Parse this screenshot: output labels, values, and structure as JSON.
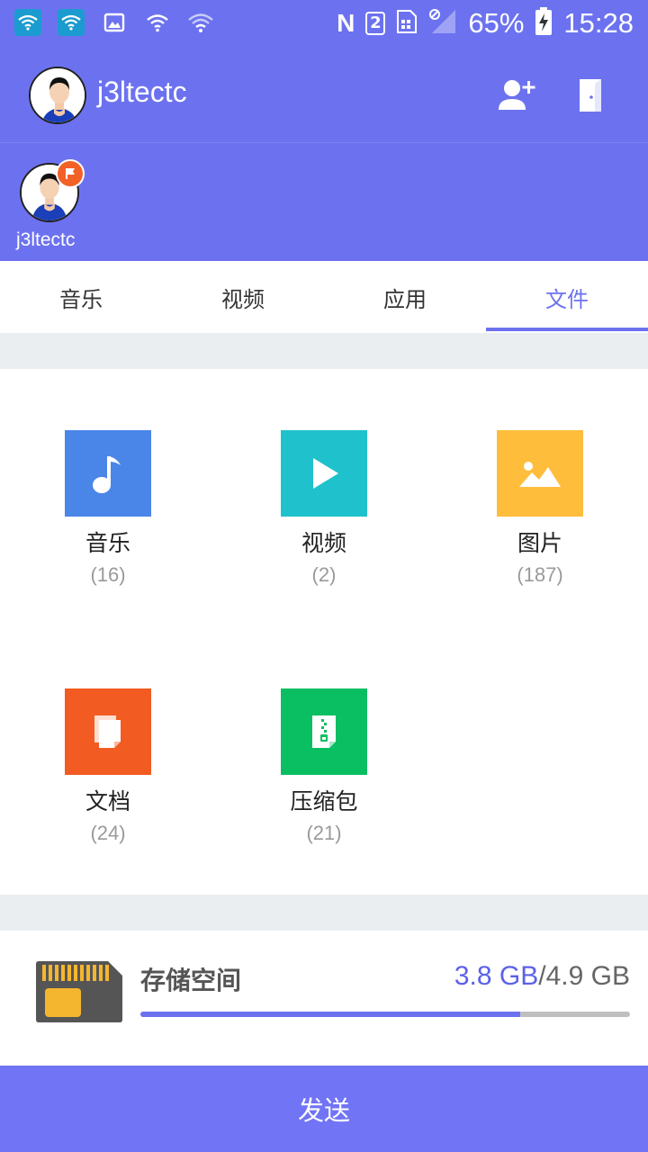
{
  "status_bar": {
    "battery": "65%",
    "time": "15:28",
    "sim_badge": "2",
    "icons": [
      "wifi-icon",
      "wifi-icon",
      "image-icon",
      "wifi-icon",
      "wifi-icon",
      "nfc-icon",
      "sim-icon",
      "no-signal-icon",
      "battery-charging-icon"
    ]
  },
  "header": {
    "username": "j3ltectc",
    "add_user_icon": "add-user-icon",
    "exit_icon": "exit-door-icon"
  },
  "peers": [
    {
      "name": "j3ltectc",
      "badge_icon": "flag-icon"
    }
  ],
  "tabs": [
    {
      "label": "音乐",
      "active": false
    },
    {
      "label": "视频",
      "active": false
    },
    {
      "label": "应用",
      "active": false
    },
    {
      "label": "文件",
      "active": true
    }
  ],
  "categories": [
    {
      "label": "音乐",
      "count": "(16)",
      "color": "#4a86e8",
      "icon": "music-note-icon"
    },
    {
      "label": "视频",
      "count": "(2)",
      "color": "#1fc2cc",
      "icon": "play-icon"
    },
    {
      "label": "图片",
      "count": "(187)",
      "color": "#ffbd3c",
      "icon": "image-icon"
    },
    {
      "label": "文档",
      "count": "(24)",
      "color": "#f25c22",
      "icon": "document-icon"
    },
    {
      "label": "压缩包",
      "count": "(21)",
      "color": "#0abf62",
      "icon": "zip-icon"
    }
  ],
  "storage": {
    "label": "存储空间",
    "used": "3.8 GB",
    "separator": "/",
    "total": "4.9 GB",
    "used_fraction": 0.7755,
    "icon": "sd-card-icon"
  },
  "send_button": {
    "label": "发送"
  },
  "colors": {
    "primary": "#6c72ef",
    "send": "#7174f5"
  }
}
